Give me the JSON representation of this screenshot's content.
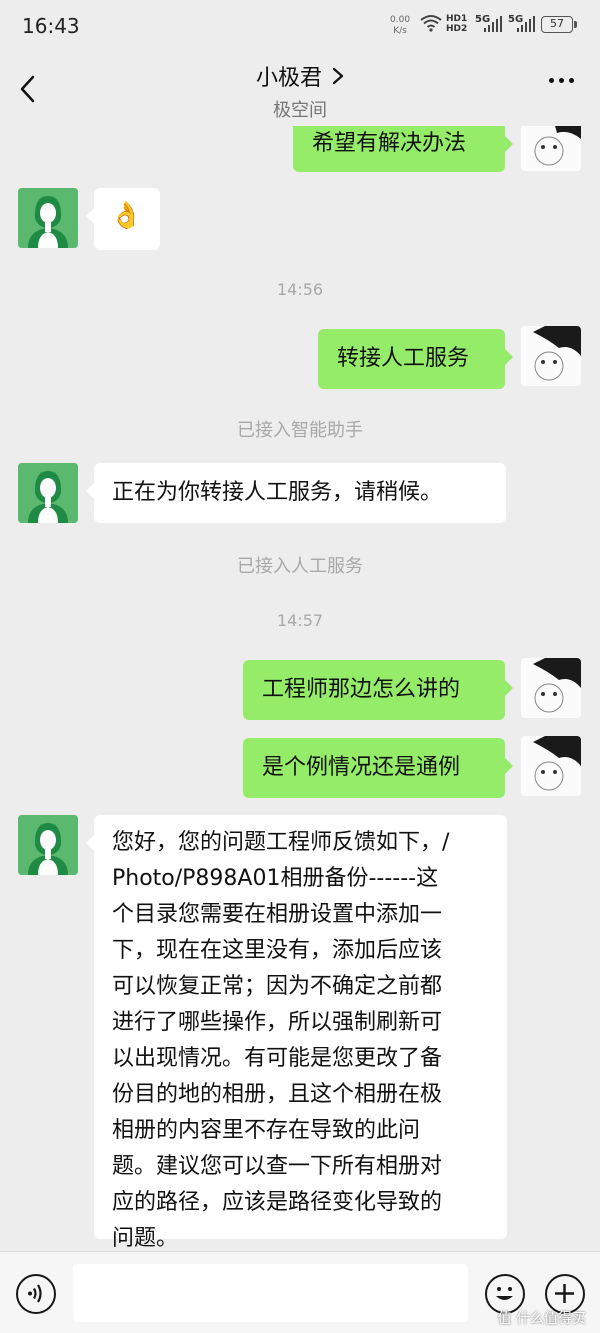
{
  "status_bar": {
    "time": "16:43",
    "net_speed": "0.00",
    "net_unit": "K/s",
    "hd1": "HD1",
    "hd2": "HD2",
    "sig1": "5G",
    "sig2": "5G",
    "battery": "57"
  },
  "header": {
    "title": "小极君",
    "subtitle": "极空间"
  },
  "messages": {
    "m1": "希望有解决办法",
    "m2": "👌",
    "t1": "14:56",
    "m3": "转接人工服务",
    "s1": "已接入智能助手",
    "m4": "正在为你转接人工服务，请稍候。",
    "s2": "已接入人工服务",
    "t2": "14:57",
    "m5": "工程师那边怎么讲的",
    "m6": "是个例情况还是通例",
    "m7_lines": [
      "您好，您的问题工程师反馈如下，/",
      "Photo/P898A01相册备份------这",
      "个目录您需要在相册设置中添加一",
      "下，现在在这里没有，添加后应该",
      "可以恢复正常；因为不确定之前都",
      "进行了哪些操作，所以强制刷新可",
      "以出现情况。有可能是您更改了备",
      "份目的地的相册，且这个相册在极",
      "相册的内容里不存在导致的此问",
      "题。建议您可以查一下所有相册对",
      "应的路径，应该是路径变化导致的",
      "问题。"
    ]
  },
  "watermark": "值 什么值得买",
  "colors": {
    "outgoing_bubble": "#95ec69",
    "incoming_bubble": "#ffffff",
    "service_avatar": "#5ab96f",
    "background": "#ededed"
  }
}
